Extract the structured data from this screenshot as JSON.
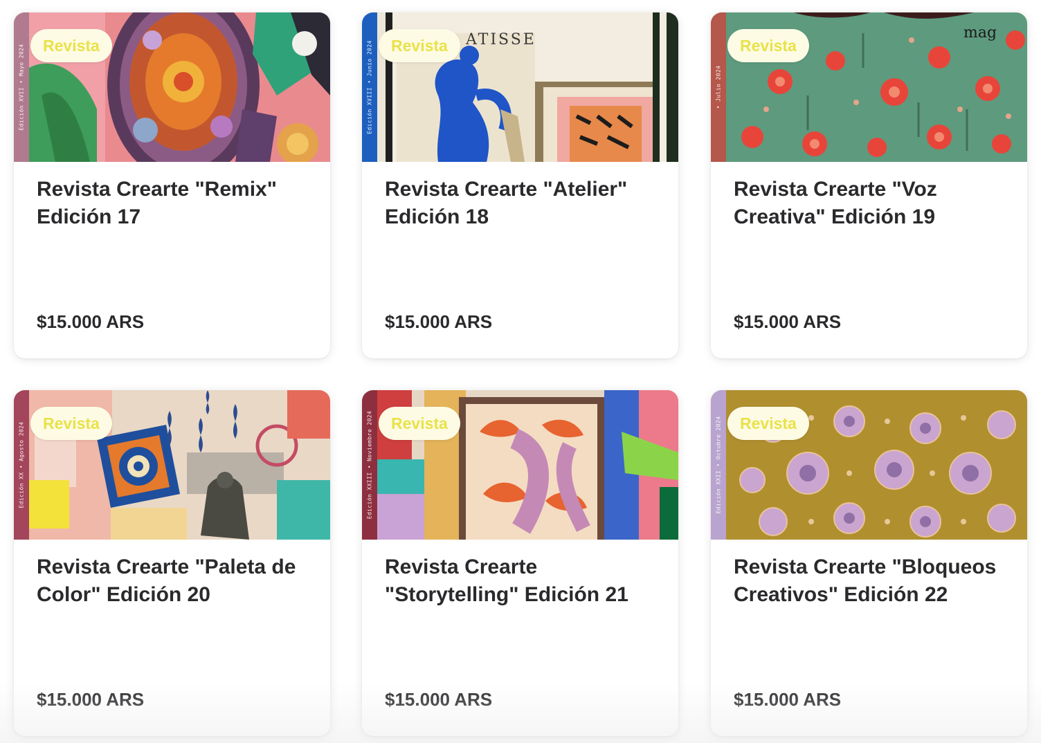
{
  "products": [
    {
      "badge": "Revista",
      "spine": "Edición XVII • Mayo 2024",
      "spine_color": "#b07a8f",
      "title": "Revista Crearte \"Remix\" Edición 17",
      "price": "$15.000 ARS"
    },
    {
      "badge": "Revista",
      "spine": "Edición XVIII • Junio 2024",
      "spine_color": "#1d5fbf",
      "cover_text": "ATISSE",
      "title": "Revista Crearte \"Atelier\" Edición 18",
      "price": "$15.000 ARS"
    },
    {
      "badge": "Revista",
      "spine": "• Julio 2024",
      "spine_color": "#b5574a",
      "cover_text": "mag",
      "title": "Revista Crearte \"Voz Creativa\" Edición 19",
      "price": "$15.000 ARS"
    },
    {
      "badge": "Revista",
      "spine": "Edición XX • Agosto 2024",
      "spine_color": "#a3455b",
      "title": "Revista Crearte \"Paleta de Color\" Edición 20",
      "price": "$15.000 ARS"
    },
    {
      "badge": "Revista",
      "spine": "Edición XXIII • Noviembre 2024",
      "spine_color": "#8d2f3f",
      "title": "Revista Crearte \"Storytelling\" Edición 21",
      "price": "$15.000 ARS"
    },
    {
      "badge": "Revista",
      "spine": "Edición XXII • Octubre 2024",
      "spine_color": "#b9a3cf",
      "title": "Revista Crearte \"Bloqueos Creativos\" Edición 22",
      "price": "$15.000 ARS"
    }
  ],
  "colors": {
    "badge_bg": "#fdfbe4",
    "badge_text": "#e9e24a",
    "text": "#2a2a2d"
  }
}
